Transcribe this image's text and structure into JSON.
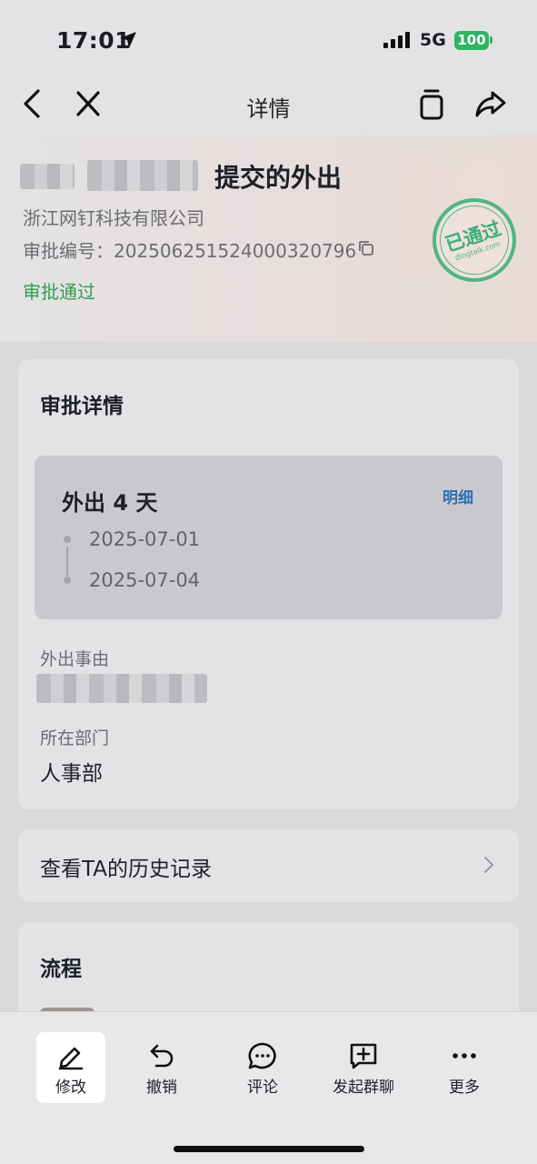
{
  "status_bar": {
    "time": "17:01",
    "network": "5G",
    "battery": "100",
    "battery_color": "#2fb560"
  },
  "nav": {
    "title": "详情",
    "back_icon": "chevron-left-icon",
    "close_icon": "close-icon",
    "copy_icon": "copy-icon",
    "share_icon": "share-icon"
  },
  "header": {
    "title_suffix": "提交的外出",
    "company": "浙江网钉科技有限公司",
    "approval_number": "审批编号：20250625152400032079​6",
    "status": "审批通过",
    "status_color": "#2e9e52",
    "stamp": {
      "main": "已通过",
      "sub": "dingtalk.com"
    }
  },
  "details": {
    "title": "审批详情",
    "outing": {
      "title": "外出 4 天",
      "link": "明细",
      "start_date": "2025-07-01",
      "end_date": "2025-07-04"
    },
    "reason_label": "外出事由",
    "department_label": "所在部门",
    "department_value": "人事部"
  },
  "history": {
    "label": "查看TA的历史记录"
  },
  "process": {
    "title": "流程"
  },
  "toolbar": {
    "items": [
      {
        "label": "修改",
        "icon": "edit-icon"
      },
      {
        "label": "撤销",
        "icon": "undo-icon"
      },
      {
        "label": "评论",
        "icon": "comment-icon"
      },
      {
        "label": "发起群聊",
        "icon": "group-chat-icon"
      },
      {
        "label": "更多",
        "icon": "more-icon"
      }
    ]
  }
}
